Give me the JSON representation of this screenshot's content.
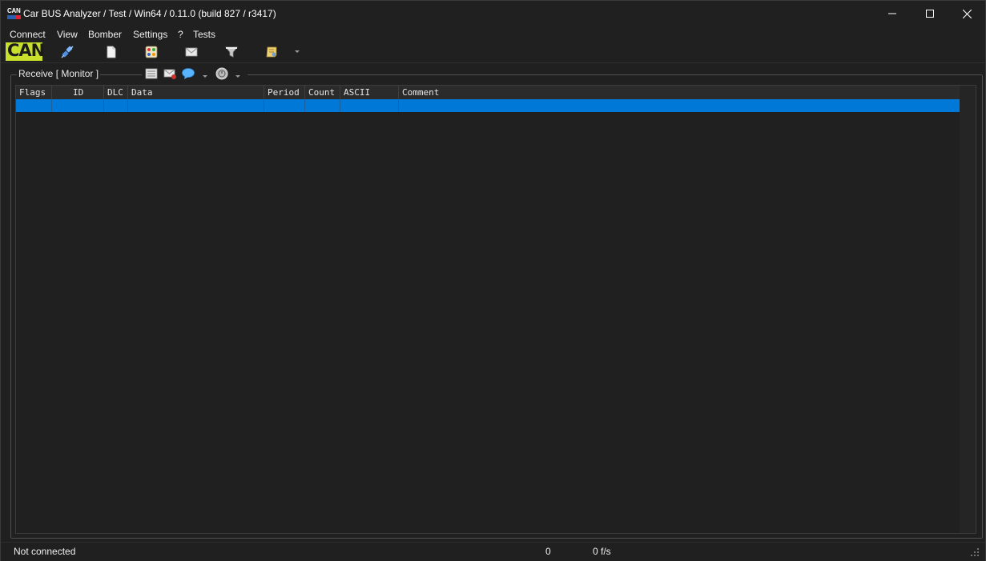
{
  "window": {
    "title": "Car BUS Analyzer / Test / Win64 / 0.11.0 (build 827 / r3417)",
    "app_icon_text": "CAN"
  },
  "menu": [
    "Connect",
    "View",
    "Bomber",
    "Settings",
    "?",
    "Tests"
  ],
  "toolbar": {
    "logo_text": "CAN",
    "icons": [
      "connect-plug-icon",
      "new-document-icon",
      "palette-icon",
      "envelope-icon",
      "filter-funnel-icon",
      "script-scroll-icon",
      "dropdown-arrow-icon"
    ]
  },
  "panel": {
    "label": "Receive [ Monitor ]",
    "tools": [
      "list-view-icon",
      "envelope-delete-icon",
      "comment-bubble-icon",
      "clock-icon"
    ]
  },
  "table": {
    "columns": [
      "Flags",
      "ID",
      "DLC",
      "Data",
      "Period",
      "Count",
      "ASCII",
      "Comment"
    ],
    "rows": [
      {
        "Flags": "",
        "ID": "",
        "DLC": "",
        "Data": "",
        "Period": "",
        "Count": "",
        "ASCII": "",
        "Comment": ""
      }
    ],
    "selected_row": 0
  },
  "status": {
    "connection": "Not connected",
    "count": "0",
    "rate": "0 f/s"
  },
  "colors": {
    "background": "#202020",
    "selection": "#0078d7",
    "logo": "#c8df2c"
  }
}
